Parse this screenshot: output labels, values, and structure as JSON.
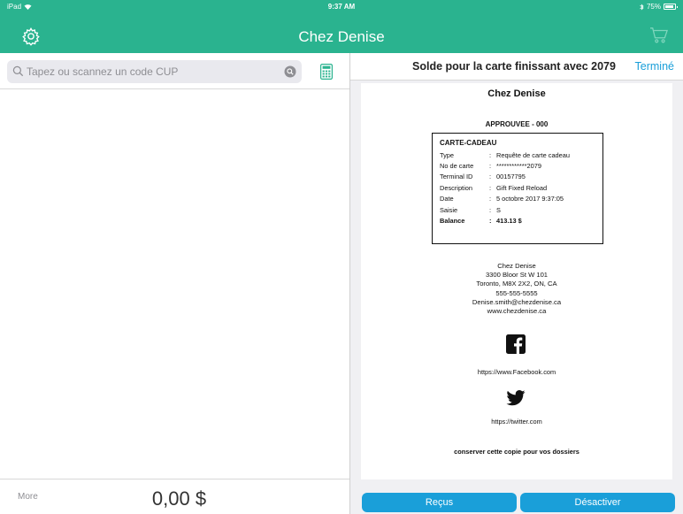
{
  "status_bar": {
    "device": "iPad",
    "time": "9:37 AM",
    "battery_text": "75%"
  },
  "header": {
    "title": "Chez Denise",
    "left_icon": "gear-icon",
    "right_icon": "cart-icon",
    "accent_color": "#2ab38f"
  },
  "left_pane": {
    "search": {
      "placeholder": "Tapez ou scannez un code CUP",
      "value": ""
    },
    "bottom": {
      "more_label": "More",
      "total": "0,00 $"
    }
  },
  "right_pane": {
    "title": "Solde pour la carte finissant avec 2079",
    "done_label": "Terminé",
    "receipt": {
      "merchant": "Chez Denise",
      "status": "APPROUVEE - 000",
      "card_title": "CARTE-CADEAU",
      "rows": [
        {
          "key": "Type",
          "value": "Requête de carte cadeau"
        },
        {
          "key": "No de carte",
          "value": "************2079"
        },
        {
          "key": "Terminal ID",
          "value": "00157795"
        },
        {
          "key": "Description",
          "value": "Gift Fixed Reload"
        },
        {
          "key": "Date",
          "value": "5 octobre 2017 9:37:05"
        },
        {
          "key": "Saisie",
          "value": "S"
        },
        {
          "key": "Balance",
          "value": "413.13 $"
        }
      ],
      "address": {
        "name": "Chez Denise",
        "street": "3300 Bloor St W 101",
        "city": "Toronto, M8X 2X2, ON, CA",
        "phone": "555-555-5555",
        "email": "Denise.smith@chezdenise.ca",
        "website": "www.chezdenise.ca"
      },
      "facebook_url": "https://www.Facebook.com",
      "twitter_url": "https://twitter.com",
      "footer_note": "conserver cette copie pour vos dossiers"
    },
    "buttons": {
      "receipts": "Reçus",
      "deactivate": "Désactiver"
    },
    "button_color": "#1a9fd9"
  }
}
